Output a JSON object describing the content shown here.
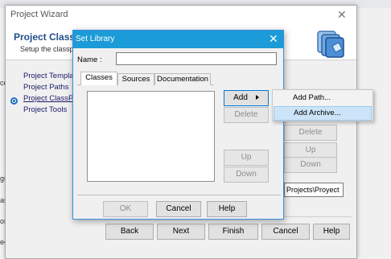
{
  "background": {
    "edge_labels": [
      "ce",
      "gu",
      "as",
      "on",
      "ec"
    ]
  },
  "wizard": {
    "title": "Project Wizard",
    "close_glyph": "✕",
    "heading": "Project ClassP",
    "subheading": "Setup the classpa",
    "steps": [
      "Project Template",
      "Project Paths",
      "Project ClassPat",
      "Project Tools"
    ],
    "side_buttons": {
      "delete": "Delete",
      "up": "Up",
      "down": "Down"
    },
    "path_value": "Projects\\Proyect",
    "nav_buttons": {
      "back": "Back",
      "next": "Next",
      "finish": "Finish",
      "cancel": "Cancel",
      "help": "Help"
    }
  },
  "set_library": {
    "title": "Set Library",
    "close_glyph": "✕",
    "name_label": "Name :",
    "name_value": "",
    "tabs": [
      "Classes",
      "Sources",
      "Documentation"
    ],
    "active_tab": "Classes",
    "buttons": {
      "add": "Add",
      "delete": "Delete",
      "up": "Up",
      "down": "Down",
      "ok": "OK",
      "cancel": "Cancel",
      "help": "Help"
    }
  },
  "add_menu": {
    "items": [
      "Add Path...",
      "Add Archive..."
    ],
    "highlighted": "Add Archive..."
  },
  "colors": {
    "dialog_titlebar": "#1b9bd7",
    "wizard_heading": "#1f4e8c",
    "menu_highlight": "#cce4f7"
  }
}
